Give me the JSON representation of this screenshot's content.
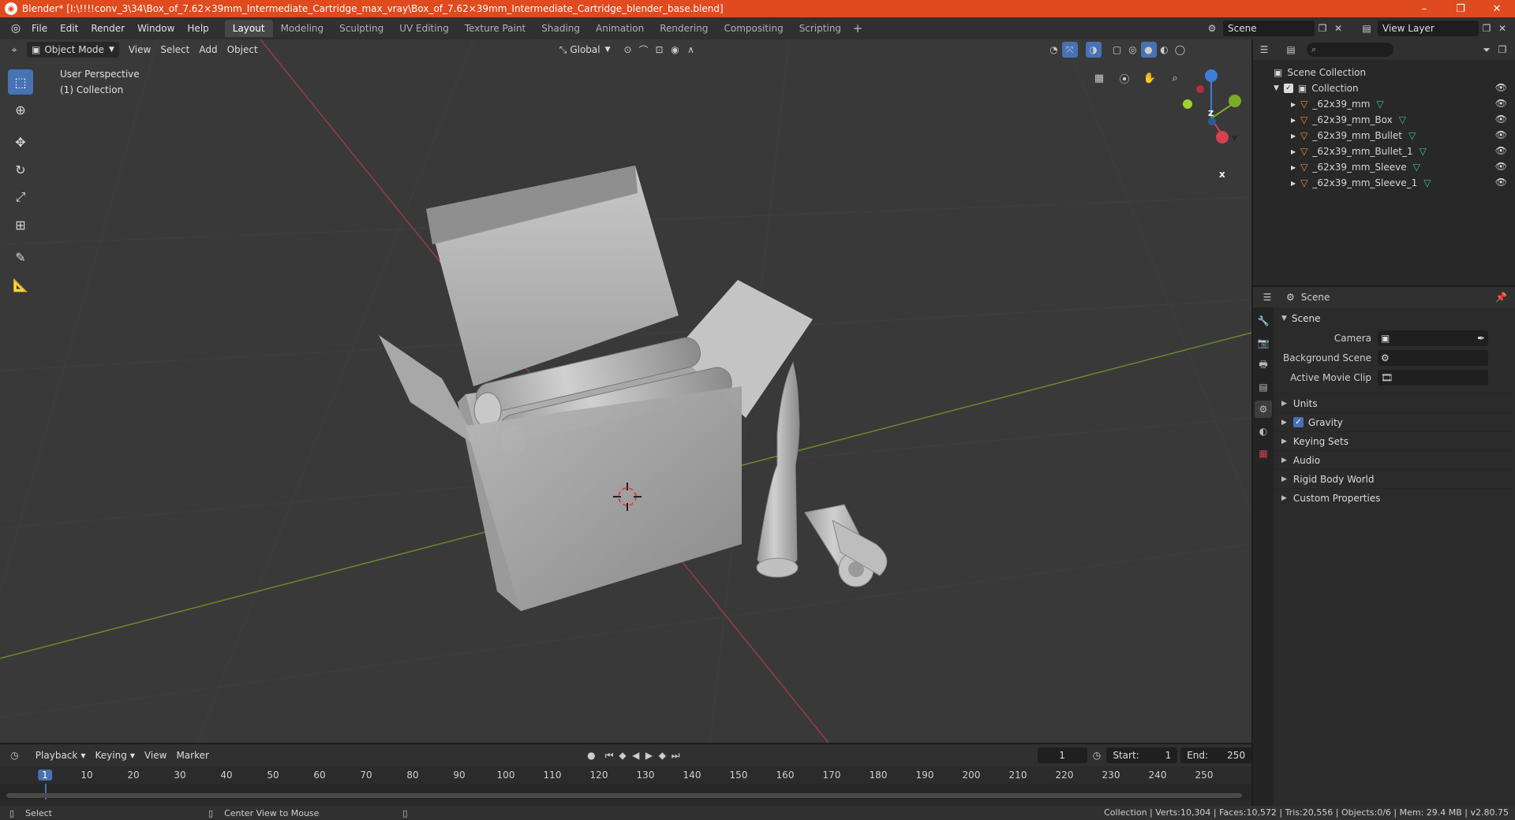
{
  "window": {
    "title": "Blender* [I:\\!!!!conv_3\\34\\Box_of_7.62×39mm_Intermediate_Cartridge_max_vray\\Box_of_7.62×39mm_Intermediate_Cartridge_blender_base.blend]",
    "controls": [
      "–",
      "❐",
      "✕"
    ]
  },
  "menubar": {
    "menus": [
      "File",
      "Edit",
      "Render",
      "Window",
      "Help"
    ],
    "workspaces": [
      "Layout",
      "Modeling",
      "Sculpting",
      "UV Editing",
      "Texture Paint",
      "Shading",
      "Animation",
      "Rendering",
      "Compositing",
      "Scripting"
    ],
    "active_workspace": "Layout",
    "scene": "Scene",
    "view_layer": "View Layer"
  },
  "viewport": {
    "mode": "Object Mode",
    "menus": [
      "View",
      "Select",
      "Add",
      "Object"
    ],
    "orientation": "Global",
    "perspective_label": "User Perspective",
    "collection_label": "(1) Collection"
  },
  "gizmo": {
    "x": "X",
    "y": "Y",
    "z": "Z"
  },
  "timeline": {
    "menus": [
      "Playback",
      "Keying",
      "View",
      "Marker"
    ],
    "current_frame": "1",
    "start_label": "Start:",
    "start": "1",
    "end_label": "End:",
    "end": "250",
    "ticks": [
      "1",
      "10",
      "20",
      "30",
      "40",
      "50",
      "60",
      "70",
      "80",
      "90",
      "100",
      "110",
      "120",
      "130",
      "140",
      "150",
      "160",
      "170",
      "180",
      "190",
      "200",
      "210",
      "220",
      "230",
      "240",
      "250"
    ]
  },
  "statusbar": {
    "select": "Select",
    "center_view": "Center View to Mouse",
    "stats": "Collection | Verts:10,304 | Faces:10,572 | Tris:20,556 | Objects:0/6 | Mem: 29.4 MB | v2.80.75"
  },
  "outliner": {
    "root": "Scene Collection",
    "collection": "Collection",
    "objects": [
      "_62x39_mm",
      "_62x39_mm_Box",
      "_62x39_mm_Bullet",
      "_62x39_mm_Bullet_1",
      "_62x39_mm_Sleeve",
      "_62x39_mm_Sleeve_1"
    ]
  },
  "properties": {
    "header": "Scene",
    "panel_title": "Scene",
    "camera_label": "Camera",
    "background_scene_label": "Background Scene",
    "active_movie_clip_label": "Active Movie Clip",
    "subpanels": [
      "Units",
      "Gravity",
      "Keying Sets",
      "Audio",
      "Rigid Body World",
      "Custom Properties"
    ]
  }
}
